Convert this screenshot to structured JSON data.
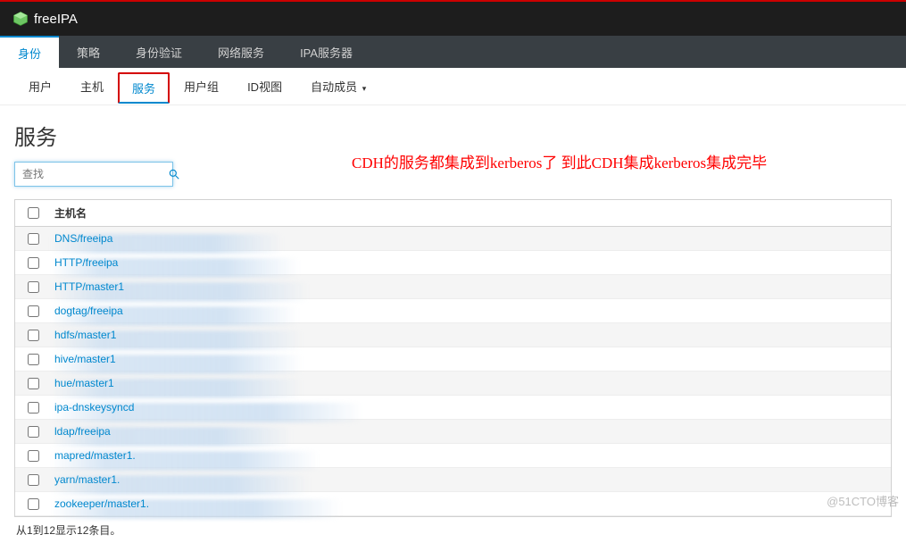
{
  "header": {
    "logo_text": "freeIPA"
  },
  "nav_primary": {
    "items": [
      {
        "label": "身份",
        "active": true
      },
      {
        "label": "策略"
      },
      {
        "label": "身份验证"
      },
      {
        "label": "网络服务"
      },
      {
        "label": "IPA服务器"
      }
    ]
  },
  "nav_secondary": {
    "items": [
      {
        "label": "用户"
      },
      {
        "label": "主机"
      },
      {
        "label": "服务",
        "active": true,
        "outlined": true
      },
      {
        "label": "用户组"
      },
      {
        "label": "ID视图"
      },
      {
        "label": "自动成员",
        "dropdown": true
      }
    ]
  },
  "page_title": "服务",
  "search": {
    "placeholder": "查找"
  },
  "annotation": "CDH的服务都集成到kerberos了 到此CDH集成kerberos集成完毕",
  "table": {
    "column_header": "主机名",
    "rows": [
      {
        "host": "DNS/freeipa",
        "blur_width": 260
      },
      {
        "host": "HTTP/freeipa",
        "blur_width": 278
      },
      {
        "host": "HTTP/master1",
        "blur_width": 288
      },
      {
        "host": "dogtag/freeipa",
        "blur_width": 277
      },
      {
        "host": "hdfs/master1",
        "blur_width": 282
      },
      {
        "host": "hive/master1",
        "blur_width": 282
      },
      {
        "host": "hue/master1",
        "blur_width": 282
      },
      {
        "host": "ipa-dnskeysyncd",
        "blur_width": 350
      },
      {
        "host": "ldap/freeipa",
        "blur_width": 270
      },
      {
        "host": "mapred/master1.",
        "blur_width": 300
      },
      {
        "host": "yarn/master1.",
        "blur_width": 290
      },
      {
        "host": "zookeeper/master1.",
        "blur_width": 325
      }
    ]
  },
  "footer_text": "从1到12显示12条目。",
  "watermark": "@51CTO博客"
}
